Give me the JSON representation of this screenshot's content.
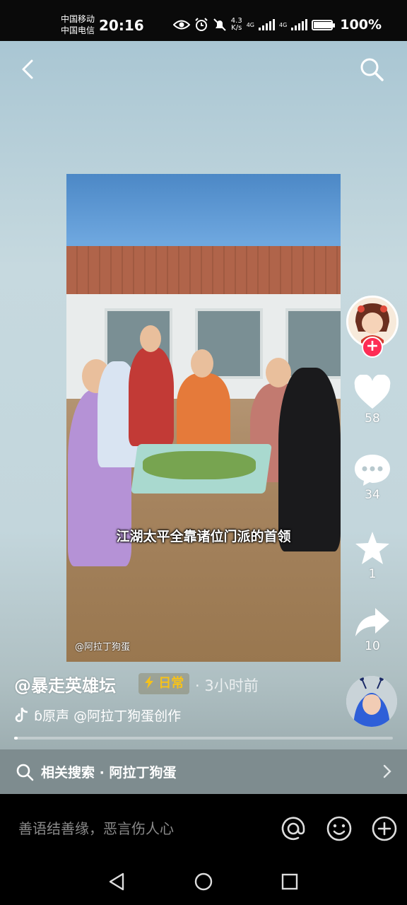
{
  "status_bar": {
    "carrier_1": "中国移动",
    "carrier_2": "中国电信",
    "time": "20:16",
    "net_speed_value": "4.3",
    "net_speed_unit": "K/s",
    "signal_1_label": "4G",
    "signal_2_label": "4G",
    "battery_percent": "100%",
    "battery_level": 1.0
  },
  "header": {
    "back_icon": "chevron-left-icon",
    "search_icon": "search-icon"
  },
  "video": {
    "subtitle": "江湖太平全靠诸位门派的首领",
    "watermark": "@阿拉丁狗蛋"
  },
  "actions": {
    "like_count": "58",
    "comment_count": "34",
    "favorite_count": "1",
    "share_count": "10",
    "follow_symbol": "+"
  },
  "post": {
    "author": "@暴走英雄坛",
    "tag": "日常",
    "time_sep": "·",
    "time": "3小时前",
    "music": "\u0002原声   @阿拉丁狗蛋创作",
    "music_display": "ɓ原声    @阿拉丁狗蛋创作",
    "progress": 0.01
  },
  "related_search": {
    "label": "相关搜索 · 阿拉丁狗蛋"
  },
  "comment_bar": {
    "placeholder": "善语结善缘，恶言伤人心",
    "mention_icon": "at-icon",
    "emoji_icon": "emoji-icon",
    "add_icon": "plus-circle-icon"
  },
  "colors": {
    "accent_red": "#fe2c55",
    "tag_yellow": "#f6c21a"
  }
}
